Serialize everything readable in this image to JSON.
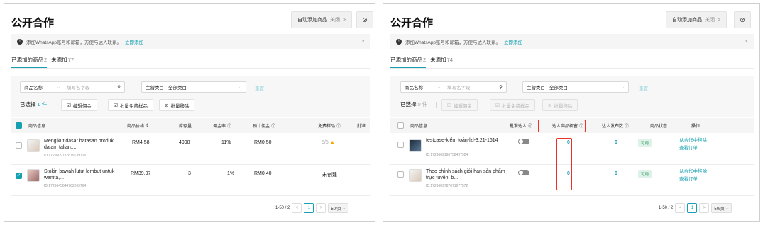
{
  "left": {
    "title": "公开合作",
    "auto_add": {
      "label": "自动添加商品",
      "status": "关闭",
      "arrow": ">"
    },
    "help_icon": "help-circle-icon",
    "notice": {
      "text": "添加WhatsApp账号和邮箱，方便与达人联系。",
      "link": "立即添加",
      "close": "×"
    },
    "tabs": [
      {
        "label": "已添加的商品",
        "count": "2"
      },
      {
        "label": "未添加",
        "count": "77"
      }
    ],
    "filter": {
      "field_select": "商品名称",
      "search_placeholder": "填写名字段",
      "category_label": "主营类目",
      "category_value": "全部类目",
      "reset": "重置"
    },
    "selected": {
      "label": "已选择",
      "count": "1 件"
    },
    "actions": [
      "编辑佣金",
      "批量免费样品",
      "批量移除"
    ],
    "columns": [
      "商品信息",
      "商品价格",
      "库存量",
      "佣金率",
      "预计佣金",
      "免费样品",
      "批准"
    ],
    "rows": [
      {
        "name": "Mengikut dasar batasan produk dalam talian,...",
        "id": "ID:1729609787679139716",
        "price": "RM4.58",
        "stock": "4998",
        "rate": "11%",
        "commission": "RM0.50",
        "sample": "5/5",
        "checked": false
      },
      {
        "name": "Stokin bawah lutut lembut untuk wanita,...",
        "id": "ID:1729645644763269764",
        "price": "RM39.97",
        "stock": "3",
        "rate": "1%",
        "commission": "RM0.40",
        "sample": "未创建",
        "checked": true
      }
    ],
    "pager": {
      "range": "1-50 / 2",
      "prev": "<",
      "page": "1",
      "next": ">",
      "size": "50/页"
    }
  },
  "right": {
    "title": "公开合作",
    "auto_add": {
      "label": "自动添加商品",
      "status": "关闭",
      "arrow": ">"
    },
    "help_icon": "help-circle-icon",
    "notice": {
      "text": "添加WhatsApp账号和邮箱，方便与达人联系。",
      "link": "立即添加",
      "close": "×"
    },
    "tabs": [
      {
        "label": "已添加的商品",
        "count": "2"
      },
      {
        "label": "未添加",
        "count": "74"
      }
    ],
    "filter": {
      "field_select": "商品名称",
      "search_placeholder": "填写名字段",
      "category_label": "主营类目",
      "category_value": "全部类目",
      "reset": "重置"
    },
    "selected": {
      "label": "已选择",
      "count": "0 件"
    },
    "actions": [
      "编辑佣金",
      "批量免费样品",
      "批量移除"
    ],
    "columns": [
      "商品信息",
      "批准达人",
      "达人商品橱窗",
      "达人发布数",
      "商品状态",
      "操作"
    ],
    "rows": [
      {
        "name": "testcase-kiểm toán-lzl-3.21-1614",
        "id": "ID:1729602196758497924",
        "showcase": "0",
        "posts": "0",
        "status": "可用",
        "op1": "从合作中移除",
        "op2": "查看订单"
      },
      {
        "name": "Theo chính sách giới hạn sản phẩm trực tuyến, b...",
        "id": "ID:1729609787671677572",
        "showcase": "0",
        "posts": "0",
        "status": "可用",
        "op1": "从合作中移除",
        "op2": "查看订单"
      }
    ],
    "pager": {
      "range": "1-50 / 2",
      "prev": "<",
      "page": "1",
      "next": ">",
      "size": "50/页"
    }
  },
  "colors": {
    "accent": "#14a0b0",
    "highlight": "#e8312a",
    "warning": "#f2a900"
  }
}
